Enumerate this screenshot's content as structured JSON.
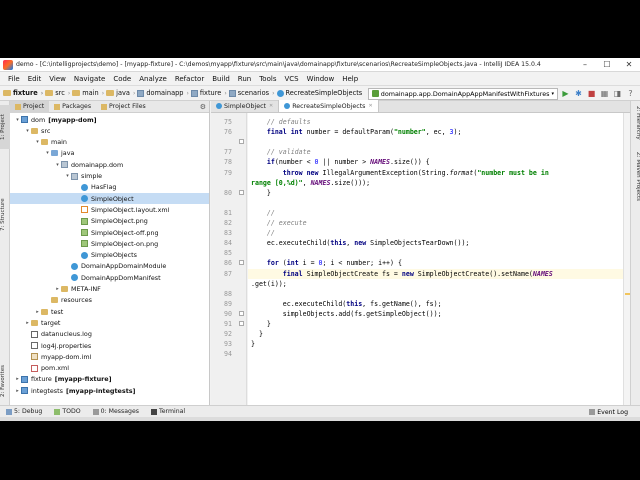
{
  "window": {
    "title": "demo - [C:\\intelligprojects\\demo] - [myapp-fixture] - C:\\demos\\myapp\\fixture\\src\\main\\java\\domainapp\\fixture\\scenarios\\RecreateSimpleObjects.java - IntelliJ IDEA 15.0.4",
    "minimize": "–",
    "maximize": "☐",
    "close": "✕"
  },
  "menu": [
    "File",
    "Edit",
    "View",
    "Navigate",
    "Code",
    "Analyze",
    "Refactor",
    "Build",
    "Run",
    "Tools",
    "VCS",
    "Window",
    "Help"
  ],
  "breadcrumbs": [
    "fixture",
    "src",
    "main",
    "java",
    "domainapp",
    "fixture",
    "scenarios",
    "RecreateSimpleObjects"
  ],
  "run_config": "domainapp.app.DomainAppAppManifestWithFixtures",
  "project_panel": {
    "tabs": [
      "Project",
      "Packages",
      "Project Files"
    ],
    "tree": [
      {
        "label": "dom",
        "bold": "[myapp-dom]",
        "depth": 0,
        "arrow": "▾",
        "icon": "module"
      },
      {
        "label": "src",
        "depth": 1,
        "arrow": "▾",
        "icon": "folder"
      },
      {
        "label": "main",
        "depth": 2,
        "arrow": "▾",
        "icon": "folder"
      },
      {
        "label": "java",
        "depth": 3,
        "arrow": "▾",
        "icon": "src"
      },
      {
        "label": "domainapp.dom",
        "depth": 4,
        "arrow": "▾",
        "icon": "pkg"
      },
      {
        "label": "simple",
        "depth": 5,
        "arrow": "▾",
        "icon": "pkg"
      },
      {
        "label": "HasFlag",
        "depth": 6,
        "arrow": "",
        "icon": "cls"
      },
      {
        "label": "SimpleObject",
        "depth": 6,
        "arrow": "",
        "icon": "cls",
        "selected": true
      },
      {
        "label": "SimpleObject.layout.xml",
        "depth": 6,
        "arrow": "",
        "icon": "xml"
      },
      {
        "label": "SimpleObject.png",
        "depth": 6,
        "arrow": "",
        "icon": "img"
      },
      {
        "label": "SimpleObject-off.png",
        "depth": 6,
        "arrow": "",
        "icon": "img"
      },
      {
        "label": "SimpleObject-on.png",
        "depth": 6,
        "arrow": "",
        "icon": "img"
      },
      {
        "label": "SimpleObjects",
        "depth": 6,
        "arrow": "",
        "icon": "cls"
      },
      {
        "label": "DomainAppDomainModule",
        "depth": 5,
        "arrow": "",
        "icon": "cls"
      },
      {
        "label": "DomainAppDomManifest",
        "depth": 5,
        "arrow": "",
        "icon": "cls"
      },
      {
        "label": "META-INF",
        "depth": 4,
        "arrow": "▸",
        "icon": "folder"
      },
      {
        "label": "resources",
        "depth": 3,
        "arrow": "",
        "icon": "folder"
      },
      {
        "label": "test",
        "depth": 2,
        "arrow": "▸",
        "icon": "folder"
      },
      {
        "label": "target",
        "depth": 1,
        "arrow": "▸",
        "icon": "folder"
      },
      {
        "label": "datanucleus.log",
        "depth": 1,
        "arrow": "",
        "icon": "log"
      },
      {
        "label": "log4j.properties",
        "depth": 1,
        "arrow": "",
        "icon": "props"
      },
      {
        "label": "myapp-dom.iml",
        "depth": 1,
        "arrow": "",
        "icon": "iml"
      },
      {
        "label": "pom.xml",
        "depth": 1,
        "arrow": "",
        "icon": "pom"
      },
      {
        "label": "fixture",
        "bold": "[myapp-fixture]",
        "depth": 0,
        "arrow": "▸",
        "icon": "module"
      },
      {
        "label": "integtests",
        "bold": "[myapp-integtests]",
        "depth": 0,
        "arrow": "▸",
        "icon": "module"
      }
    ]
  },
  "editor": {
    "tabs": [
      "SimpleObject",
      "RecreateSimpleObjects"
    ],
    "active_tab": 1,
    "current_line": 87,
    "lines": [
      {
        "n": "75",
        "html": "    <span class=\"cm\">// defaults</span>"
      },
      {
        "n": "76",
        "html": "    <span class=\"kw\">final int</span> number = defaultParam(<span class=\"st\">\"number\"</span>, ec, <span class=\"nm\">3</span>);"
      },
      {
        "n": "",
        "html": ""
      },
      {
        "n": "77",
        "html": "    <span class=\"cm\">// validate</span>"
      },
      {
        "n": "78",
        "html": "    <span class=\"kw\">if</span>(number &lt; <span class=\"nm\">0</span> || number &gt; <span class=\"cst\">NAMES</span>.size()) {"
      },
      {
        "n": "79",
        "html": "        <span class=\"kw\">throw new</span> IllegalArgumentException(String.<span class=\"it\">format</span>(<span class=\"st\">\"number must be in</span>"
      },
      {
        "n": "",
        "html": "<span class=\"st\">range [0,%d)\"</span>, <span class=\"cst\">NAMES</span>.size()));"
      },
      {
        "n": "80",
        "html": "    }"
      },
      {
        "n": "",
        "html": ""
      },
      {
        "n": "81",
        "html": "    <span class=\"cm\">//</span>"
      },
      {
        "n": "82",
        "html": "    <span class=\"cm\">// execute</span>"
      },
      {
        "n": "83",
        "html": "    <span class=\"cm\">//</span>"
      },
      {
        "n": "84",
        "html": "    ec.executeChild(<span class=\"kw\">this</span>, <span class=\"kw\">new</span> SimpleObjectsTearDown());"
      },
      {
        "n": "85",
        "html": ""
      },
      {
        "n": "86",
        "html": "    <span class=\"kw\">for</span> (<span class=\"kw\">int</span> i = <span class=\"nm\">0</span>; i &lt; number; i++) {"
      },
      {
        "n": "87",
        "html": "        <span class=\"kw\">final</span> SimpleObjectCreate fs = <span class=\"kw\">new</span> SimpleObjectCreate().setName(<span class=\"cst\">NAMES</span>"
      },
      {
        "n": "",
        "html": ".get(i));"
      },
      {
        "n": "88",
        "html": ""
      },
      {
        "n": "89",
        "html": "        ec.executeChild(<span class=\"kw\">this</span>, fs.getName(), fs);"
      },
      {
        "n": "90",
        "html": "        simpleObjects.add(fs.getSimpleObject());"
      },
      {
        "n": "91",
        "html": "    }"
      },
      {
        "n": "92",
        "html": "  }"
      },
      {
        "n": "93",
        "html": "}"
      },
      {
        "n": "94",
        "html": ""
      }
    ]
  },
  "left_stripe": [
    "1: Project",
    "7: Structure",
    "2: Favorites"
  ],
  "right_stripe": [
    "2: Hierarchy",
    "Z: Maven Projects"
  ],
  "bottom_tools": [
    "5: Debug",
    "TODO",
    "0: Messages",
    "Terminal"
  ],
  "event_log": "Event Log"
}
